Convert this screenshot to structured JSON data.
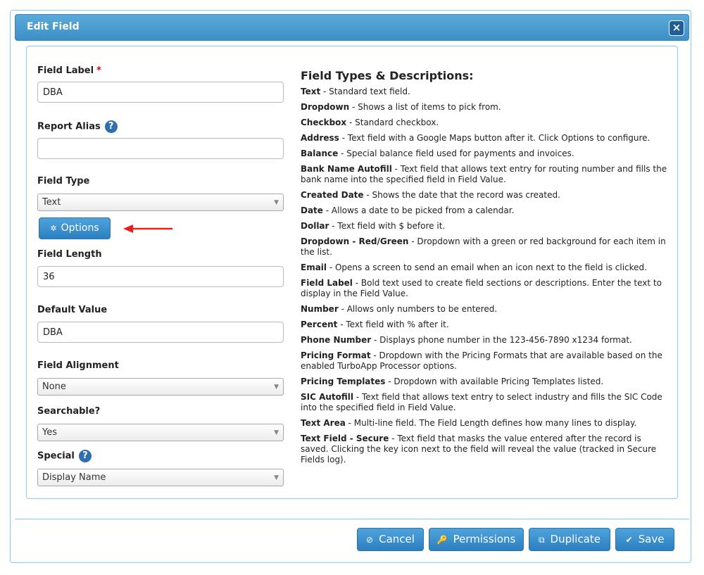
{
  "dialog": {
    "title": "Edit Field",
    "close_icon": "×"
  },
  "form": {
    "field_label": {
      "label": "Field Label",
      "required_mark": "*",
      "value": "DBA"
    },
    "report_alias": {
      "label": "Report Alias",
      "help": "?",
      "value": ""
    },
    "field_type": {
      "label": "Field Type",
      "value": "Text"
    },
    "options_button": {
      "icon": "✲",
      "label": "Options"
    },
    "field_length": {
      "label": "Field Length",
      "value": "36"
    },
    "default_value": {
      "label": "Default Value",
      "value": "DBA"
    },
    "field_alignment": {
      "label": "Field Alignment",
      "value": "None"
    },
    "searchable": {
      "label": "Searchable?",
      "value": "Yes"
    },
    "special": {
      "label": "Special",
      "help": "?",
      "value": "Display Name"
    }
  },
  "descriptions": {
    "heading": "Field Types & Descriptions:",
    "items": [
      {
        "name": "Text",
        "desc": " - Standard text field."
      },
      {
        "name": "Dropdown",
        "desc": " - Shows a list of items to pick from."
      },
      {
        "name": "Checkbox",
        "desc": " - Standard checkbox."
      },
      {
        "name": "Address",
        "desc": " - Text field with a Google Maps button after it. Click Options to configure."
      },
      {
        "name": "Balance",
        "desc": " - Special balance field used for payments and invoices."
      },
      {
        "name": "Bank Name Autofill",
        "desc": " - Text field that allows text entry for routing number and fills the bank name into the specified field in Field Value."
      },
      {
        "name": "Created Date",
        "desc": " - Shows the date that the record was created."
      },
      {
        "name": "Date",
        "desc": " - Allows a date to be picked from a calendar."
      },
      {
        "name": "Dollar",
        "desc": " - Text field with $ before it."
      },
      {
        "name": "Dropdown - Red/Green",
        "desc": " - Dropdown with a green or red background for each item in the list."
      },
      {
        "name": "Email",
        "desc": " - Opens a screen to send an email when an icon next to the field is clicked."
      },
      {
        "name": "Field Label",
        "desc": " - Bold text used to create field sections or descriptions. Enter the text to display in the Field Value."
      },
      {
        "name": "Number",
        "desc": " - Allows only numbers to be entered."
      },
      {
        "name": "Percent",
        "desc": " - Text field with % after it."
      },
      {
        "name": "Phone Number",
        "desc": " - Displays phone number in the 123-456-7890 x1234 format."
      },
      {
        "name": "Pricing Format",
        "desc": " - Dropdown with the Pricing Formats that are available based on the enabled TurboApp Processor options."
      },
      {
        "name": "Pricing Templates",
        "desc": " - Dropdown with available Pricing Templates listed."
      },
      {
        "name": "SIC Autofill",
        "desc": " - Text field that allows text entry to select industry and fills the SIC Code into the specified field in Field Value."
      },
      {
        "name": "Text Area",
        "desc": " - Multi-line field. The Field Length defines how many lines to display."
      },
      {
        "name": "Text Field - Secure",
        "desc": " - Text field that masks the value entered after the record is saved. Clicking the key icon next to the field will reveal the value (tracked in Secure Fields log)."
      }
    ]
  },
  "footer": {
    "cancel": {
      "icon": "⊘",
      "label": "Cancel"
    },
    "permissions": {
      "icon": "🔑",
      "label": "Permissions"
    },
    "duplicate": {
      "icon": "⧉",
      "label": "Duplicate"
    },
    "save": {
      "icon": "✔",
      "label": "Save"
    }
  },
  "colors": {
    "accent": "#3d8fc7",
    "arrow": "#e02020"
  }
}
